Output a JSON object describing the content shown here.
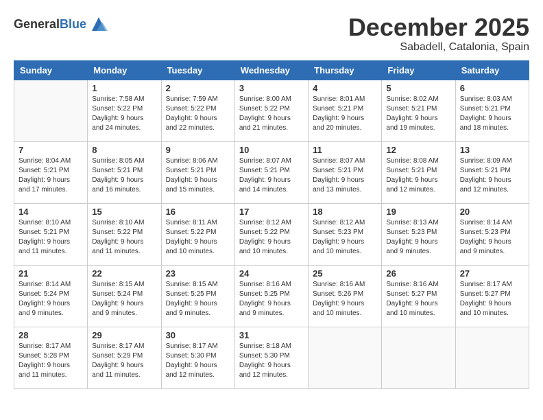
{
  "header": {
    "logo_general": "General",
    "logo_blue": "Blue",
    "month": "December 2025",
    "location": "Sabadell, Catalonia, Spain"
  },
  "weekdays": [
    "Sunday",
    "Monday",
    "Tuesday",
    "Wednesday",
    "Thursday",
    "Friday",
    "Saturday"
  ],
  "weeks": [
    [
      {
        "date": "",
        "info": ""
      },
      {
        "date": "1",
        "info": "Sunrise: 7:58 AM\nSunset: 5:22 PM\nDaylight: 9 hours\nand 24 minutes."
      },
      {
        "date": "2",
        "info": "Sunrise: 7:59 AM\nSunset: 5:22 PM\nDaylight: 9 hours\nand 22 minutes."
      },
      {
        "date": "3",
        "info": "Sunrise: 8:00 AM\nSunset: 5:22 PM\nDaylight: 9 hours\nand 21 minutes."
      },
      {
        "date": "4",
        "info": "Sunrise: 8:01 AM\nSunset: 5:21 PM\nDaylight: 9 hours\nand 20 minutes."
      },
      {
        "date": "5",
        "info": "Sunrise: 8:02 AM\nSunset: 5:21 PM\nDaylight: 9 hours\nand 19 minutes."
      },
      {
        "date": "6",
        "info": "Sunrise: 8:03 AM\nSunset: 5:21 PM\nDaylight: 9 hours\nand 18 minutes."
      }
    ],
    [
      {
        "date": "7",
        "info": "Sunrise: 8:04 AM\nSunset: 5:21 PM\nDaylight: 9 hours\nand 17 minutes."
      },
      {
        "date": "8",
        "info": "Sunrise: 8:05 AM\nSunset: 5:21 PM\nDaylight: 9 hours\nand 16 minutes."
      },
      {
        "date": "9",
        "info": "Sunrise: 8:06 AM\nSunset: 5:21 PM\nDaylight: 9 hours\nand 15 minutes."
      },
      {
        "date": "10",
        "info": "Sunrise: 8:07 AM\nSunset: 5:21 PM\nDaylight: 9 hours\nand 14 minutes."
      },
      {
        "date": "11",
        "info": "Sunrise: 8:07 AM\nSunset: 5:21 PM\nDaylight: 9 hours\nand 13 minutes."
      },
      {
        "date": "12",
        "info": "Sunrise: 8:08 AM\nSunset: 5:21 PM\nDaylight: 9 hours\nand 12 minutes."
      },
      {
        "date": "13",
        "info": "Sunrise: 8:09 AM\nSunset: 5:21 PM\nDaylight: 9 hours\nand 12 minutes."
      }
    ],
    [
      {
        "date": "14",
        "info": "Sunrise: 8:10 AM\nSunset: 5:21 PM\nDaylight: 9 hours\nand 11 minutes."
      },
      {
        "date": "15",
        "info": "Sunrise: 8:10 AM\nSunset: 5:22 PM\nDaylight: 9 hours\nand 11 minutes."
      },
      {
        "date": "16",
        "info": "Sunrise: 8:11 AM\nSunset: 5:22 PM\nDaylight: 9 hours\nand 10 minutes."
      },
      {
        "date": "17",
        "info": "Sunrise: 8:12 AM\nSunset: 5:22 PM\nDaylight: 9 hours\nand 10 minutes."
      },
      {
        "date": "18",
        "info": "Sunrise: 8:12 AM\nSunset: 5:23 PM\nDaylight: 9 hours\nand 10 minutes."
      },
      {
        "date": "19",
        "info": "Sunrise: 8:13 AM\nSunset: 5:23 PM\nDaylight: 9 hours\nand 9 minutes."
      },
      {
        "date": "20",
        "info": "Sunrise: 8:14 AM\nSunset: 5:23 PM\nDaylight: 9 hours\nand 9 minutes."
      }
    ],
    [
      {
        "date": "21",
        "info": "Sunrise: 8:14 AM\nSunset: 5:24 PM\nDaylight: 9 hours\nand 9 minutes."
      },
      {
        "date": "22",
        "info": "Sunrise: 8:15 AM\nSunset: 5:24 PM\nDaylight: 9 hours\nand 9 minutes."
      },
      {
        "date": "23",
        "info": "Sunrise: 8:15 AM\nSunset: 5:25 PM\nDaylight: 9 hours\nand 9 minutes."
      },
      {
        "date": "24",
        "info": "Sunrise: 8:16 AM\nSunset: 5:25 PM\nDaylight: 9 hours\nand 9 minutes."
      },
      {
        "date": "25",
        "info": "Sunrise: 8:16 AM\nSunset: 5:26 PM\nDaylight: 9 hours\nand 10 minutes."
      },
      {
        "date": "26",
        "info": "Sunrise: 8:16 AM\nSunset: 5:27 PM\nDaylight: 9 hours\nand 10 minutes."
      },
      {
        "date": "27",
        "info": "Sunrise: 8:17 AM\nSunset: 5:27 PM\nDaylight: 9 hours\nand 10 minutes."
      }
    ],
    [
      {
        "date": "28",
        "info": "Sunrise: 8:17 AM\nSunset: 5:28 PM\nDaylight: 9 hours\nand 11 minutes."
      },
      {
        "date": "29",
        "info": "Sunrise: 8:17 AM\nSunset: 5:29 PM\nDaylight: 9 hours\nand 11 minutes."
      },
      {
        "date": "30",
        "info": "Sunrise: 8:17 AM\nSunset: 5:30 PM\nDaylight: 9 hours\nand 12 minutes."
      },
      {
        "date": "31",
        "info": "Sunrise: 8:18 AM\nSunset: 5:30 PM\nDaylight: 9 hours\nand 12 minutes."
      },
      {
        "date": "",
        "info": ""
      },
      {
        "date": "",
        "info": ""
      },
      {
        "date": "",
        "info": ""
      }
    ]
  ]
}
